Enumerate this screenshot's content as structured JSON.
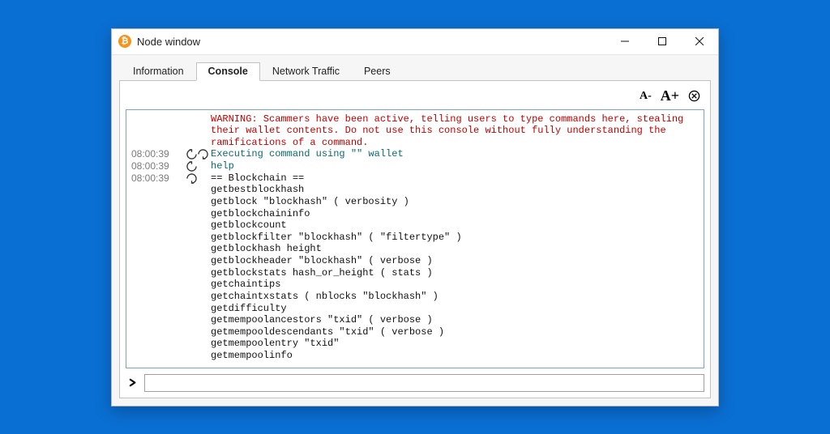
{
  "window": {
    "title": "Node window",
    "app_icon_glyph": "₿"
  },
  "tabs": [
    {
      "label": "Information",
      "active": false
    },
    {
      "label": "Console",
      "active": true
    },
    {
      "label": "Network Traffic",
      "active": false
    },
    {
      "label": "Peers",
      "active": false
    }
  ],
  "toolbar": {
    "font_smaller": "A-",
    "font_larger": "A+"
  },
  "console": {
    "warning": "WARNING: Scammers have been active, telling users to type commands here, stealing their wallet contents. Do not use this console without fully understanding the ramifications of a command.",
    "entries": [
      {
        "time": "08:00:39",
        "dir": "out-in",
        "text": "Executing command using \"\" wallet",
        "kind": "cmd"
      },
      {
        "time": "08:00:39",
        "dir": "in",
        "text": "help",
        "kind": "cmd"
      },
      {
        "time": "08:00:39",
        "dir": "out",
        "kind": "body",
        "text": "== Blockchain ==\ngetbestblockhash\ngetblock \"blockhash\" ( verbosity )\ngetblockchaininfo\ngetblockcount\ngetblockfilter \"blockhash\" ( \"filtertype\" )\ngetblockhash height\ngetblockheader \"blockhash\" ( verbose )\ngetblockstats hash_or_height ( stats )\ngetchaintips\ngetchaintxstats ( nblocks \"blockhash\" )\ngetdifficulty\ngetmempoolancestors \"txid\" ( verbose )\ngetmempooldescendants \"txid\" ( verbose )\ngetmempoolentry \"txid\"\ngetmempoolinfo"
      }
    ]
  },
  "input": {
    "value": "",
    "placeholder": ""
  }
}
